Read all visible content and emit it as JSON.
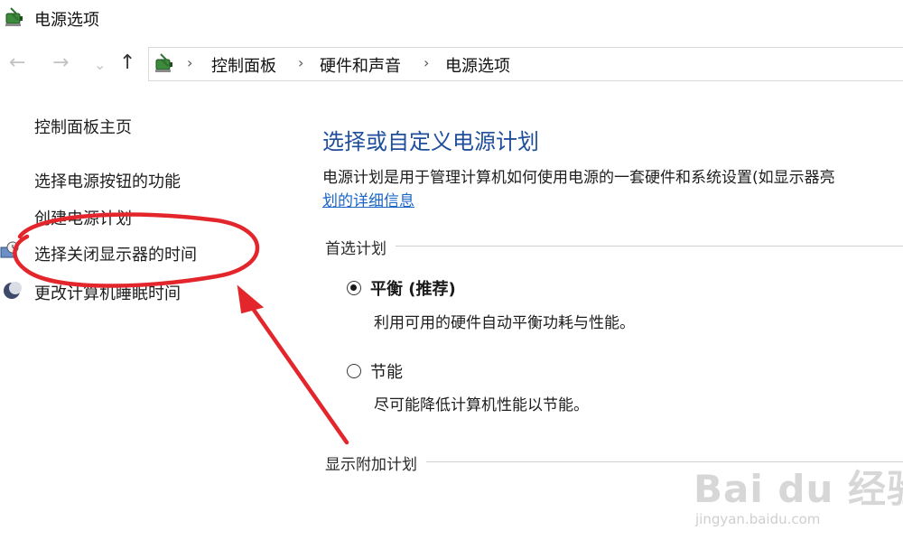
{
  "window": {
    "title": "电源选项"
  },
  "address": {
    "crumbs": [
      "控制面板",
      "硬件和声音",
      "电源选项"
    ]
  },
  "nav": {
    "back": "←",
    "forward": "→",
    "recent": "⌄",
    "up": "↑",
    "separator": "›"
  },
  "sidebar": {
    "home": "控制面板主页",
    "links": [
      "选择电源按钮的功能",
      "创建电源计划",
      "选择关闭显示器的时间",
      "更改计算机睡眠时间"
    ]
  },
  "main": {
    "title": "选择或自定义电源计划",
    "description": "电源计划是用于管理计算机如何使用电源的一套硬件和系统设置(如显示器亮",
    "description_link": "划的详细信息",
    "preferred_group": "首选计划",
    "plans": [
      {
        "name": "平衡 (推荐)",
        "desc": "利用可用的硬件自动平衡功耗与性能。",
        "selected": true
      },
      {
        "name": "节能",
        "desc": "尽可能降低计算机性能以节能。",
        "selected": false
      }
    ],
    "additional_group": "显示附加计划"
  },
  "annotation": {
    "color": "#e3262b",
    "target": "选择关闭显示器的时间"
  },
  "watermark": {
    "brand": "Bai du 经验",
    "url": "jingyan.baidu.com"
  },
  "colors": {
    "title_blue": "#1f4e9b",
    "link_blue": "#1a66c9"
  }
}
